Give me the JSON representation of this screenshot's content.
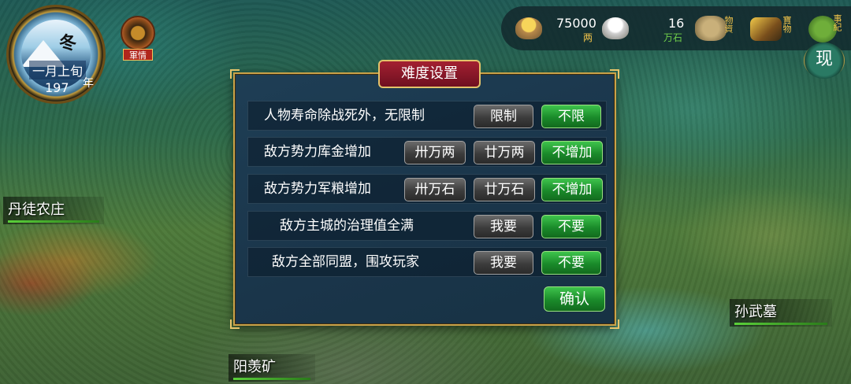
{
  "season": {
    "season": "冬",
    "month": "一月上旬",
    "year": "197",
    "year_char": "年"
  },
  "intel": {
    "label": "軍情"
  },
  "resources": {
    "gold": {
      "value": "75000",
      "unit": "两"
    },
    "food": {
      "value": "16",
      "unit": "万石"
    },
    "goods_label": "物資",
    "treasure_label": "寶物",
    "chronicle_label": "事紀"
  },
  "now_button": "现",
  "map_labels": {
    "dantu": "丹徒农庄",
    "sunwu": "孙武墓",
    "yangxian": "阳羡矿"
  },
  "dialog": {
    "title": "难度设置",
    "rows": [
      {
        "label": "人物寿命除战死外，无限制",
        "options": [
          "限制",
          "不限"
        ],
        "selected": "不限"
      },
      {
        "label": "敌方势力库金增加",
        "options": [
          "卅万两",
          "廿万两",
          "不增加"
        ],
        "selected": "不增加"
      },
      {
        "label": "敌方势力军粮增加",
        "options": [
          "卅万石",
          "廿万石",
          "不增加"
        ],
        "selected": "不增加"
      },
      {
        "label": "敌方主城的治理值全满",
        "options": [
          "我要",
          "不要"
        ],
        "selected": "不要"
      },
      {
        "label": "敌方全部同盟，围攻玩家",
        "options": [
          "我要",
          "不要"
        ],
        "selected": "不要"
      }
    ],
    "confirm": "确认"
  },
  "colors": {
    "selected": "#1a8a2a",
    "unselected": "#3c3c3c",
    "title": "#a32031",
    "border": "#c9a24a"
  }
}
